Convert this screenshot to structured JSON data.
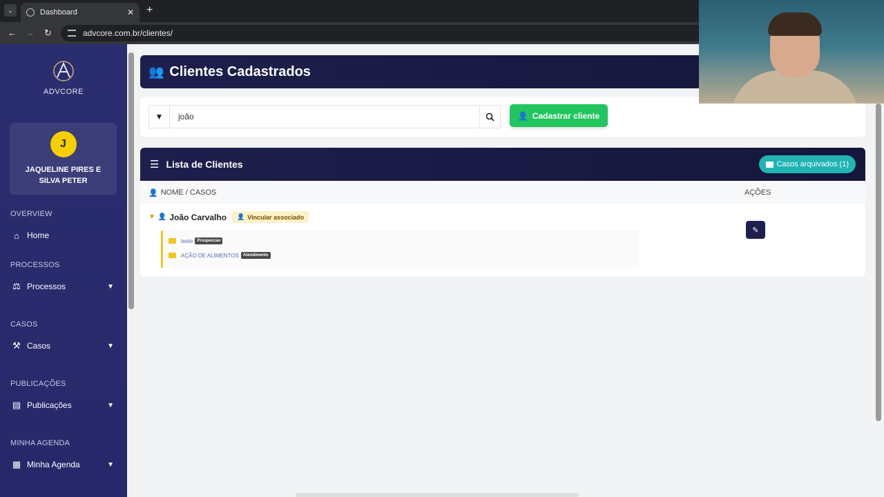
{
  "browser": {
    "tab_title": "Dashboard",
    "url": "advcore.com.br/clientes/"
  },
  "sidebar": {
    "logo_text": "ADVCORE",
    "user_initial": "J",
    "user_name": "JAQUELINE PIRES E SILVA PETER",
    "sections": [
      {
        "label": "OVERVIEW",
        "item": "Home"
      },
      {
        "label": "PROCESSOS",
        "item": "Processos"
      },
      {
        "label": "CASOS",
        "item": "Casos"
      },
      {
        "label": "PUBLICAÇÕES",
        "item": "Publicações"
      },
      {
        "label": "MINHA AGENDA",
        "item": "Minha Agenda"
      }
    ]
  },
  "header": {
    "title": "Clientes Cadastrados"
  },
  "filter": {
    "search_value": "joão",
    "register_label": "Cadastrar cliente"
  },
  "list": {
    "title": "Lista de Clientes",
    "archived_label": "Casos arquivados (1)",
    "col_name": "NOME / CASOS",
    "col_actions": "AÇÕES",
    "client": {
      "name": "João Carvalho",
      "link_label": "Vincular associado",
      "cases": [
        {
          "name": "teste",
          "status": "Prospeccao"
        },
        {
          "name": "AÇÃO DE ALIMENTOS",
          "status": "Atendimento"
        }
      ]
    }
  },
  "colors": {
    "sidebar_bg": "#2b2e6e",
    "header_bg": "#1e1f4d",
    "accent_yellow": "#f5c518",
    "success_green": "#22c55e",
    "teal_badge": "#22b3b3"
  }
}
